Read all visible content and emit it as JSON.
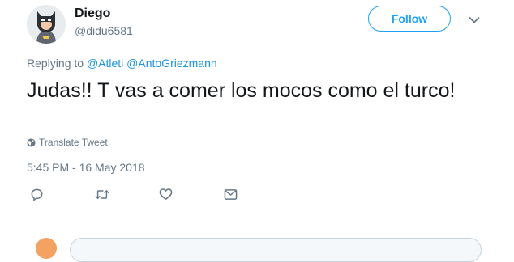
{
  "tweet": {
    "author": {
      "name": "Diego",
      "handle": "@didu6581"
    },
    "follow_label": "Follow",
    "replying_prefix": "Replying to",
    "replying_to": [
      "@Atleti",
      "@AntoGriezmann"
    ],
    "text": "Judas!! T vas a comer los mocos como el turco!",
    "translate_label": "Translate Tweet",
    "timestamp": "5:45 PM - 16 May 2018"
  },
  "actions": [
    {
      "icon": "reply-icon"
    },
    {
      "icon": "retweet-icon"
    },
    {
      "icon": "like-icon"
    },
    {
      "icon": "direct-message-icon"
    }
  ],
  "colors": {
    "accent": "#1da1f2",
    "link": "#1b95e0",
    "secondary_text": "#657786",
    "primary_text": "#14171a"
  }
}
